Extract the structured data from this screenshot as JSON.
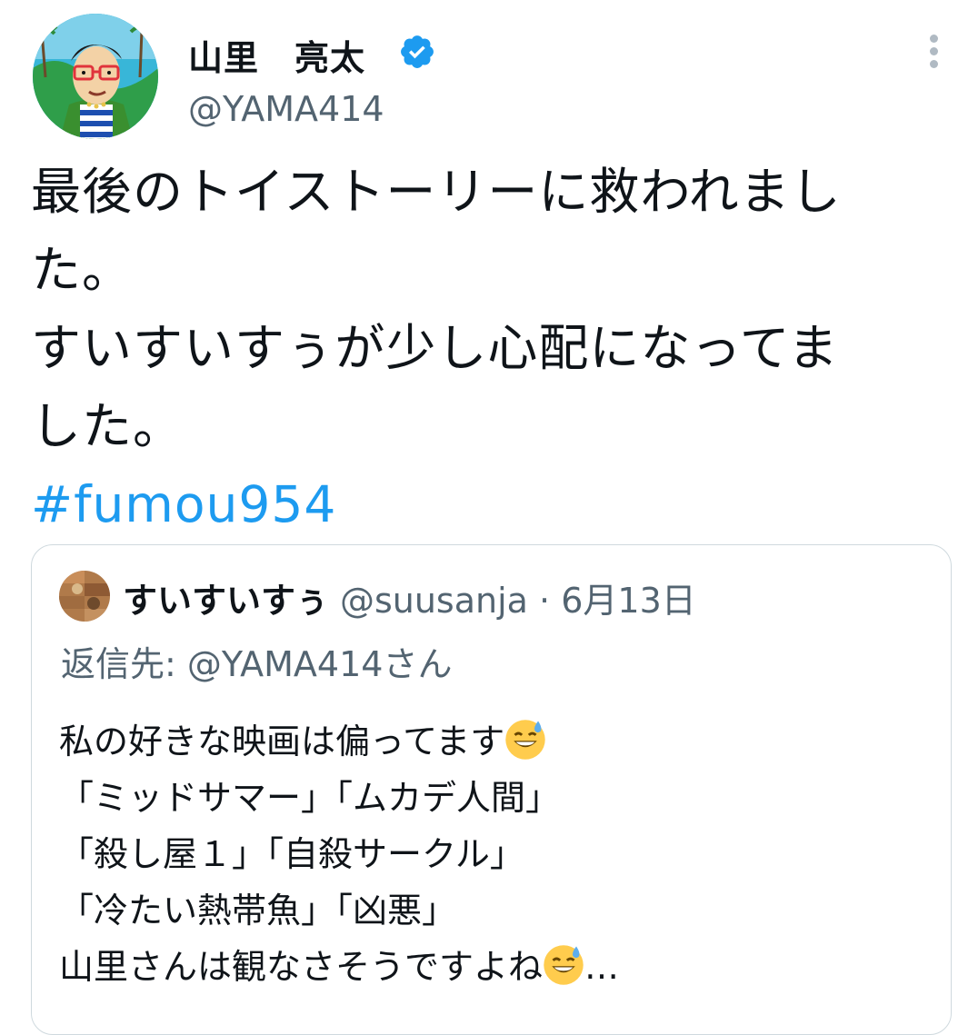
{
  "tweet": {
    "display_name": "山里　亮太",
    "handle": "@YAMA414",
    "verified_icon": "verified-badge-icon",
    "more_icon": "more-vertical-icon",
    "text_lines": [
      "最後のトイストーリーに救われまし",
      "た。",
      "すいすいすぅが少し心配になってま",
      "した。"
    ],
    "hashtag": "#fumou954"
  },
  "quote": {
    "name": "すいすいすぅ",
    "handle": "@suusanja",
    "separator": "·",
    "date": "6月13日",
    "reply_to": "返信先: @YAMA414さん",
    "body_lines": [
      "私の好きな映画は偏ってます",
      "「ミッドサマー」「ムカデ人間」",
      "「殺し屋１」「自殺サークル」",
      "「冷たい熱帯魚」「凶悪」",
      "山里さんは観なさそうですよね"
    ],
    "ellipsis": "…",
    "emoji_name": "grinning-face-with-sweat-emoji"
  },
  "colors": {
    "link": "#1d9bf0",
    "secondary_text": "#536471",
    "border": "#cfd9de"
  }
}
